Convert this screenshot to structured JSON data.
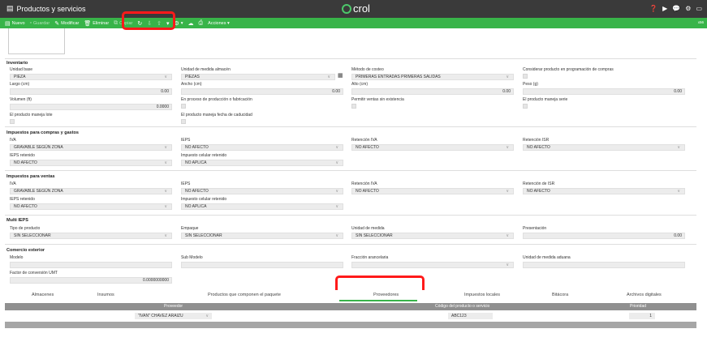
{
  "titlebar": {
    "title": "Productos y servicios",
    "brand": "crol",
    "icons": [
      "help-icon",
      "video-icon",
      "chat-icon",
      "settings-icon",
      "window-icon"
    ]
  },
  "toolbar": {
    "nuevo": "Nuevo",
    "guardar": "Guardar",
    "modificar": "Modificar",
    "eliminar": "Eliminar",
    "copiar": "Copiar",
    "acciones": "Acciones ▾",
    "badge": "x56"
  },
  "inventario": {
    "title": "Inventario",
    "unidad_base_label": "Unidad base",
    "unidad_base": "PIEZA",
    "unidad_almacen_label": "Unidad de medida almacén",
    "unidad_almacen": "PIEZAS",
    "metodo_label": "Método de costeo",
    "metodo": "PRIMERAS ENTRADAS PRIMERAS SALIDAS",
    "considerar_label": "Considerar producto en programación de compras",
    "largo_label": "Largo (cm)",
    "largo": "0.00",
    "ancho_label": "Ancho (cm)",
    "ancho": "0.00",
    "alto_label": "Alto (cm)",
    "alto": "0.00",
    "peso_label": "Peso (g)",
    "peso": "0.00",
    "volumen_label": "Volumen (ft)",
    "volumen": "0.0000",
    "proceso_label": "En proceso de producción o fabricación",
    "permitir_label": "Permitir ventas sin existencia",
    "serie_label": "El producto maneja serie",
    "lote_label": "El producto maneja lote",
    "caducidad_label": "El producto maneja fecha de caducidad"
  },
  "impuestos_compras": {
    "title": "Impuestos para compras y gastos",
    "iva_label": "IVA",
    "iva": "GRAVABLE SEGÚN ZONA",
    "ieps_label": "IEPS",
    "ieps": "NO AFECTO",
    "ret_iva_label": "Retención IVA",
    "ret_iva": "NO AFECTO",
    "ret_isr_label": "Retención ISR",
    "ret_isr": "NO AFECTO",
    "ieps_ret_label": "IEPS retenido",
    "ieps_ret": "NO AFECTO",
    "celular_label": "Impuesto celular retenido",
    "celular": "NO APLICA"
  },
  "impuestos_ventas": {
    "title": "Impuestos para ventas",
    "iva_label": "IVA",
    "iva": "GRAVABLE SEGÚN ZONA",
    "ieps_label": "IEPS",
    "ieps": "NO AFECTO",
    "ret_iva_label": "Retención IVA",
    "ret_iva": "NO AFECTO",
    "ret_isr_label": "Retención de ISR",
    "ret_isr": "NO AFECTO",
    "ieps_ret_label": "IEPS retenido",
    "ieps_ret": "NO AFECTO",
    "celular_label": "Impuesto celular retenido",
    "celular": "NO APLICA"
  },
  "multi_ieps": {
    "title": "Multi IEPS",
    "tipo_label": "Tipo de producto",
    "tipo": "SIN SELECCIONAR",
    "empaque_label": "Empaque",
    "empaque": "SIN SELECCIONAR",
    "unidad_label": "Unidad de medida",
    "unidad": "SIN SELECCIONAR",
    "presentacion_label": "Presentación",
    "presentacion": "0.00"
  },
  "comercio": {
    "title": "Comercio exterior",
    "modelo_label": "Modelo",
    "submodelo_label": "Sub Modelo",
    "fraccion_label": "Fracción arancelaria",
    "unidad_aduana_label": "Unidad de medida aduana",
    "factor_label": "Factor de conversión UMT",
    "factor": "0.0000000000"
  },
  "tabs": [
    "Almacenes",
    "Insumos",
    "Productos que componen el paquete",
    "Proveedores",
    "Impuestos locales",
    "Bitácora",
    "Archivos digitales"
  ],
  "grid": {
    "headers": [
      "Proveedor",
      "Código del producto o servicio",
      "Prioridad"
    ],
    "proveedor": "\"IVAN\" CHAVEZ ARAIZU",
    "codigo": "ABC123",
    "prioridad": "1"
  }
}
